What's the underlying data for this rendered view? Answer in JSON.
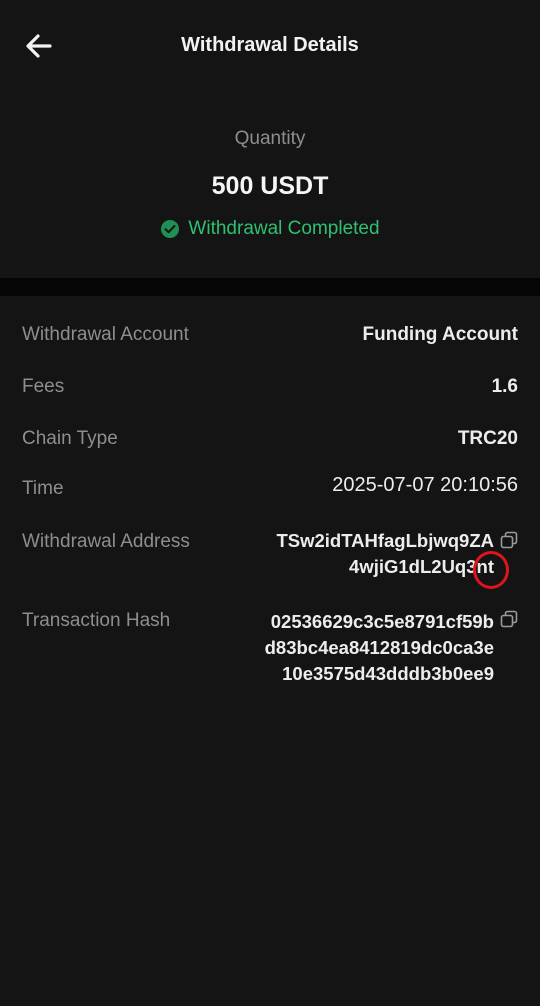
{
  "header": {
    "title": "Withdrawal Details",
    "back_icon": "arrow-left-icon"
  },
  "summary": {
    "quantity_label": "Quantity",
    "quantity_value": "500 USDT",
    "status_text": "Withdrawal Completed",
    "status_icon": "check-circle-icon",
    "status_color": "#2fbf71"
  },
  "details": {
    "withdrawal_account": {
      "label": "Withdrawal Account",
      "value": "Funding Account"
    },
    "fees": {
      "label": "Fees",
      "value": "1.6"
    },
    "chain_type": {
      "label": "Chain Type",
      "value": "TRC20"
    },
    "time": {
      "label": "Time",
      "value": "2025-07-07 20:10:56"
    },
    "withdrawal_address": {
      "label": "Withdrawal Address",
      "lines": [
        "TSw2idTAHfagLbjwq9ZA",
        "4wjiG1dL2Uq3nt"
      ],
      "copy_icon": "copy-icon"
    },
    "transaction_hash": {
      "label": "Transaction Hash",
      "lines": [
        "02536629c3c5e8791cf59b",
        "d83bc4ea8412819dc0ca3e",
        "10e3575d43dddb3b0ee9"
      ],
      "copy_icon": "copy-icon"
    }
  },
  "annotation_color": "#e0141c"
}
